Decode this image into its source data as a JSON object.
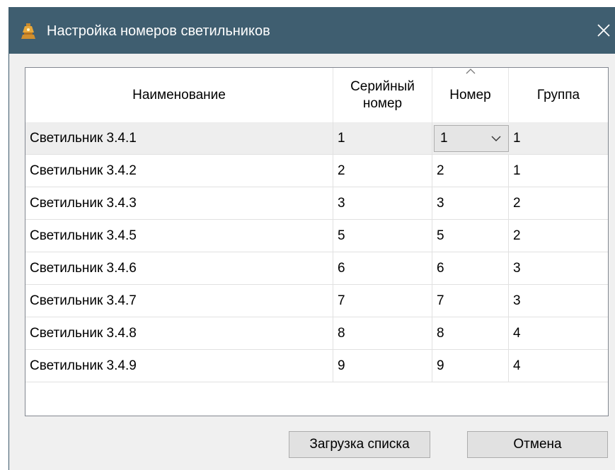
{
  "window": {
    "title": "Настройка номеров светильников",
    "title_bar_color": "#3f5e70"
  },
  "icons": {
    "app": "lamp-icon",
    "close": "close-icon",
    "sort": "sort-ascending-icon",
    "dropdown": "chevron-down-icon"
  },
  "table": {
    "columns": [
      "Наименование",
      "Серийный номер",
      "Номер",
      "Группа"
    ],
    "sorted_column": "Номер",
    "rows": [
      {
        "name": "Светильник 3.4.1",
        "serial": "1",
        "number": "1",
        "group": "1"
      },
      {
        "name": "Светильник 3.4.2",
        "serial": "2",
        "number": "2",
        "group": "1"
      },
      {
        "name": "Светильник 3.4.3",
        "serial": "3",
        "number": "3",
        "group": "2"
      },
      {
        "name": "Светильник 3.4.5",
        "serial": "5",
        "number": "5",
        "group": "2"
      },
      {
        "name": "Светильник 3.4.6",
        "serial": "6",
        "number": "6",
        "group": "3"
      },
      {
        "name": "Светильник 3.4.7",
        "serial": "7",
        "number": "7",
        "group": "3"
      },
      {
        "name": "Светильник 3.4.8",
        "serial": "8",
        "number": "8",
        "group": "4"
      },
      {
        "name": "Светильник 3.4.9",
        "serial": "9",
        "number": "9",
        "group": "4"
      }
    ],
    "selected_row": 0,
    "editing_combo_value": "1"
  },
  "buttons": {
    "load_list": "Загрузка списка",
    "cancel": "Отмена"
  }
}
